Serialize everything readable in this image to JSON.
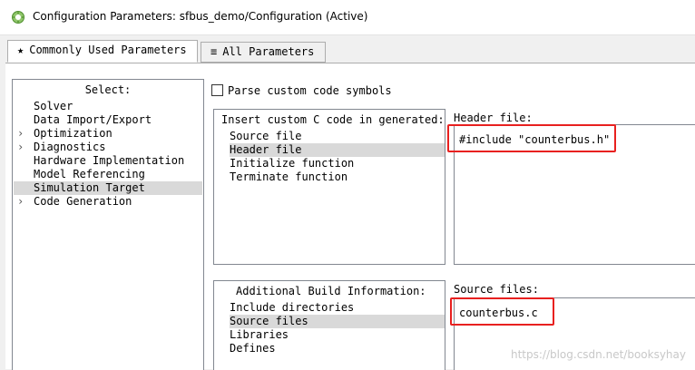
{
  "window": {
    "title": "Configuration Parameters: sfbus_demo/Configuration (Active)",
    "icon": "matlab-gear-icon"
  },
  "tabs": [
    {
      "label": "Commonly Used Parameters",
      "glyph": "★",
      "icon": "star-icon",
      "active": true
    },
    {
      "label": "All Parameters",
      "glyph": "≡",
      "icon": "list-icon",
      "active": false
    }
  ],
  "select_pane": {
    "title": "Select:",
    "items": [
      {
        "label": "Solver",
        "expandable": false,
        "selected": false
      },
      {
        "label": "Data Import/Export",
        "expandable": false,
        "selected": false
      },
      {
        "label": "Optimization",
        "expandable": true,
        "selected": false
      },
      {
        "label": "Diagnostics",
        "expandable": true,
        "selected": false
      },
      {
        "label": "Hardware Implementation",
        "expandable": false,
        "selected": false
      },
      {
        "label": "Model Referencing",
        "expandable": false,
        "selected": false
      },
      {
        "label": "Simulation Target",
        "expandable": false,
        "selected": true
      },
      {
        "label": "Code Generation",
        "expandable": true,
        "selected": false
      }
    ]
  },
  "parse_custom_code": {
    "label": "Parse custom code symbols",
    "checked": false
  },
  "custom_code": {
    "header": "Insert custom C code in generated:",
    "items": [
      "Source file",
      "Header file",
      "Initialize function",
      "Terminate function"
    ],
    "selected_index": 1
  },
  "header_file": {
    "label": "Header file:",
    "value": "#include \"counterbus.h\""
  },
  "build_info": {
    "header": "Additional Build Information:",
    "items": [
      "Include directories",
      "Source files",
      "Libraries",
      "Defines"
    ],
    "selected_index": 1
  },
  "source_files": {
    "label": "Source files:",
    "value": "counterbus.c"
  },
  "watermark": "https://blog.csdn.net/booksyhay",
  "colors": {
    "highlight": "#e8201f",
    "selection": "#d9d9d9"
  }
}
